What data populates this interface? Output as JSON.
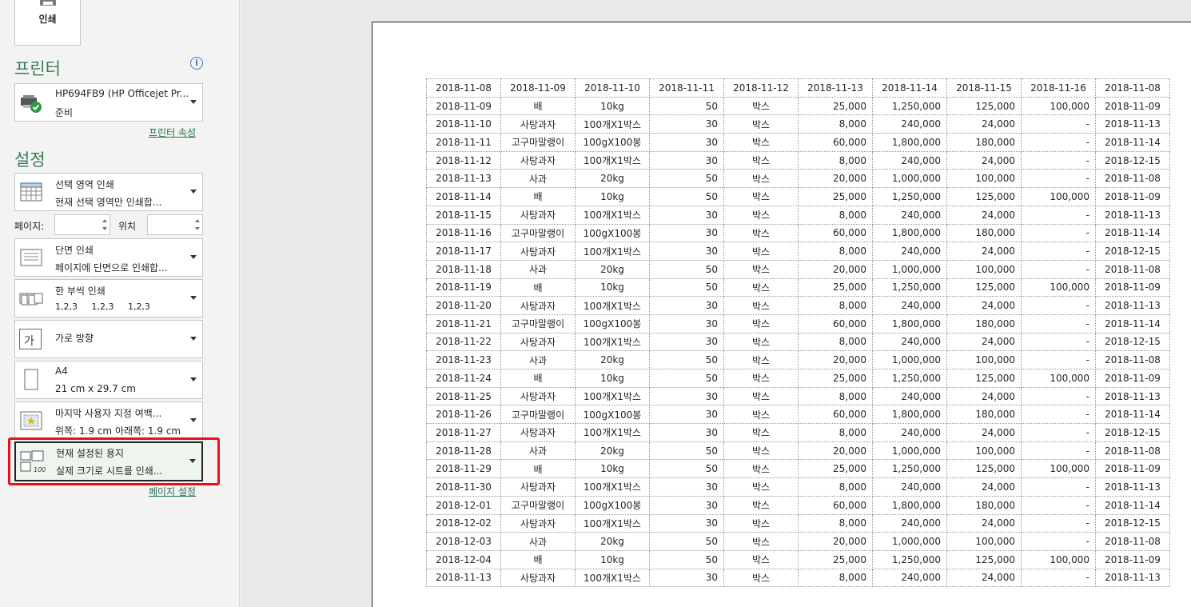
{
  "print_button": {
    "label": "인쇄"
  },
  "printer": {
    "section_title": "프린터",
    "info_icon": "i",
    "name": "HP694FB9 (HP Officejet Pr...",
    "status": "준비",
    "properties_link": "프린터 속성"
  },
  "settings": {
    "section_title": "설정",
    "scope": {
      "title": "선택 영역 인쇄",
      "sub": "현재 선택 영역만 인쇄합..."
    },
    "pages_label": "페이지:",
    "to_label": "위치",
    "sides": {
      "title": "단면 인쇄",
      "sub": "페이지에 단면으로 인쇄합..."
    },
    "collate": {
      "title": "한 부씩 인쇄",
      "sub": "1,2,3     1,2,3     1,2,3"
    },
    "orientation": {
      "title": "가로 방향",
      "icon_text": "가"
    },
    "paper": {
      "title": "A4",
      "sub": "21 cm x 29.7 cm"
    },
    "margins": {
      "title": "마지막 사용자 지정 여백...",
      "sub": "위쪽: 1.9 cm 아래쪽: 1.9 cm"
    },
    "scaling": {
      "title": "현재 설정된 용지",
      "sub": "실제 크기로 시트를 인쇄...",
      "icon_text": "100"
    },
    "page_setup_link": "페이지 설정"
  },
  "sheet": {
    "header": [
      "2018-11-08",
      "2018-11-09",
      "2018-11-10",
      "2018-11-11",
      "2018-11-12",
      "2018-11-13",
      "2018-11-14",
      "2018-11-15",
      "2018-11-16",
      "2018-11-08"
    ],
    "rows": [
      [
        "2018-11-09",
        "배",
        "10kg",
        "50",
        "박스",
        "25,000",
        "1,250,000",
        "125,000",
        "100,000",
        "2018-11-09"
      ],
      [
        "2018-11-10",
        "사탕과자",
        "100개X1박스",
        "30",
        "박스",
        "8,000",
        "240,000",
        "24,000",
        "-",
        "2018-11-13"
      ],
      [
        "2018-11-11",
        "고구마말랭이",
        "100gX100봉",
        "30",
        "박스",
        "60,000",
        "1,800,000",
        "180,000",
        "-",
        "2018-11-14"
      ],
      [
        "2018-11-12",
        "사탕과자",
        "100개X1박스",
        "30",
        "박스",
        "8,000",
        "240,000",
        "24,000",
        "-",
        "2018-12-15"
      ],
      [
        "2018-11-13",
        "사과",
        "20kg",
        "50",
        "박스",
        "20,000",
        "1,000,000",
        "100,000",
        "-",
        "2018-11-08"
      ],
      [
        "2018-11-14",
        "배",
        "10kg",
        "50",
        "박스",
        "25,000",
        "1,250,000",
        "125,000",
        "100,000",
        "2018-11-09"
      ],
      [
        "2018-11-15",
        "사탕과자",
        "100개X1박스",
        "30",
        "박스",
        "8,000",
        "240,000",
        "24,000",
        "-",
        "2018-11-13"
      ],
      [
        "2018-11-16",
        "고구마말랭이",
        "100gX100봉",
        "30",
        "박스",
        "60,000",
        "1,800,000",
        "180,000",
        "-",
        "2018-11-14"
      ],
      [
        "2018-11-17",
        "사탕과자",
        "100개X1박스",
        "30",
        "박스",
        "8,000",
        "240,000",
        "24,000",
        "-",
        "2018-12-15"
      ],
      [
        "2018-11-18",
        "사과",
        "20kg",
        "50",
        "박스",
        "20,000",
        "1,000,000",
        "100,000",
        "-",
        "2018-11-08"
      ],
      [
        "2018-11-19",
        "배",
        "10kg",
        "50",
        "박스",
        "25,000",
        "1,250,000",
        "125,000",
        "100,000",
        "2018-11-09"
      ],
      [
        "2018-11-20",
        "사탕과자",
        "100개X1박스",
        "30",
        "박스",
        "8,000",
        "240,000",
        "24,000",
        "-",
        "2018-11-13"
      ],
      [
        "2018-11-21",
        "고구마말랭이",
        "100gX100봉",
        "30",
        "박스",
        "60,000",
        "1,800,000",
        "180,000",
        "-",
        "2018-11-14"
      ],
      [
        "2018-11-22",
        "사탕과자",
        "100개X1박스",
        "30",
        "박스",
        "8,000",
        "240,000",
        "24,000",
        "-",
        "2018-12-15"
      ],
      [
        "2018-11-23",
        "사과",
        "20kg",
        "50",
        "박스",
        "20,000",
        "1,000,000",
        "100,000",
        "-",
        "2018-11-08"
      ],
      [
        "2018-11-24",
        "배",
        "10kg",
        "50",
        "박스",
        "25,000",
        "1,250,000",
        "125,000",
        "100,000",
        "2018-11-09"
      ],
      [
        "2018-11-25",
        "사탕과자",
        "100개X1박스",
        "30",
        "박스",
        "8,000",
        "240,000",
        "24,000",
        "-",
        "2018-11-13"
      ],
      [
        "2018-11-26",
        "고구마말랭이",
        "100gX100봉",
        "30",
        "박스",
        "60,000",
        "1,800,000",
        "180,000",
        "-",
        "2018-11-14"
      ],
      [
        "2018-11-27",
        "사탕과자",
        "100개X1박스",
        "30",
        "박스",
        "8,000",
        "240,000",
        "24,000",
        "-",
        "2018-12-15"
      ],
      [
        "2018-11-28",
        "사과",
        "20kg",
        "50",
        "박스",
        "20,000",
        "1,000,000",
        "100,000",
        "-",
        "2018-11-08"
      ],
      [
        "2018-11-29",
        "배",
        "10kg",
        "50",
        "박스",
        "25,000",
        "1,250,000",
        "125,000",
        "100,000",
        "2018-11-09"
      ],
      [
        "2018-11-30",
        "사탕과자",
        "100개X1박스",
        "30",
        "박스",
        "8,000",
        "240,000",
        "24,000",
        "-",
        "2018-11-13"
      ],
      [
        "2018-12-01",
        "고구마말랭이",
        "100gX100봉",
        "30",
        "박스",
        "60,000",
        "1,800,000",
        "180,000",
        "-",
        "2018-11-14"
      ],
      [
        "2018-12-02",
        "사탕과자",
        "100개X1박스",
        "30",
        "박스",
        "8,000",
        "240,000",
        "24,000",
        "-",
        "2018-12-15"
      ],
      [
        "2018-12-03",
        "사과",
        "20kg",
        "50",
        "박스",
        "20,000",
        "1,000,000",
        "100,000",
        "-",
        "2018-11-08"
      ],
      [
        "2018-12-04",
        "배",
        "10kg",
        "50",
        "박스",
        "25,000",
        "1,250,000",
        "125,000",
        "100,000",
        "2018-11-09"
      ],
      [
        "2018-11-13",
        "사탕과자",
        "100개X1박스",
        "30",
        "박스",
        "8,000",
        "240,000",
        "24,000",
        "-",
        "2018-11-13"
      ]
    ]
  }
}
